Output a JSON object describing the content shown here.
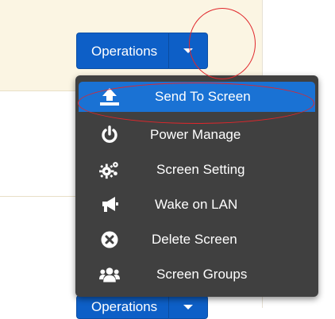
{
  "operations_button": {
    "label": "Operations"
  },
  "operations_bottom": {
    "label": "Operations"
  },
  "menu": {
    "items": [
      {
        "label": "Send To Screen",
        "icon": "upload-icon",
        "active": true
      },
      {
        "label": "Power Manage",
        "icon": "power-icon"
      },
      {
        "label": "Screen Setting",
        "icon": "gears-icon"
      },
      {
        "label": "Wake on LAN",
        "icon": "bullhorn-icon"
      },
      {
        "label": "Delete Screen",
        "icon": "delete-circle-icon"
      },
      {
        "label": "Screen Groups",
        "icon": "users-icon"
      }
    ]
  },
  "colors": {
    "button_blue": "#0d5fc7",
    "menu_bg": "#404040",
    "active_item": "#1a72d4",
    "annotation_red": "#e0262b",
    "table_bg": "#fbf5e3"
  }
}
